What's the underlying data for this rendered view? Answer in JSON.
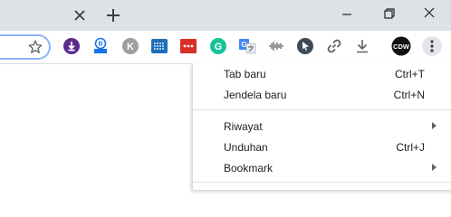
{
  "tabstrip": {
    "close_icon": "close-icon",
    "new_tab_icon": "plus-icon"
  },
  "window_controls": [
    "minimize-icon",
    "restore-icon",
    "close-icon"
  ],
  "toolbar": {
    "bookmark_icon": "star-icon",
    "extensions": [
      {
        "icon": "download-manager-icon",
        "color": "#5b2c8f"
      },
      {
        "icon": "extension-b-icon",
        "color": "#1a73e8"
      },
      {
        "icon": "k-icon",
        "color": "#9e9e9e",
        "text": "K"
      },
      {
        "icon": "grid-extension-icon",
        "color": "#1e6fb9"
      },
      {
        "icon": "red-extension-icon",
        "color": "#d93025"
      },
      {
        "icon": "grammarly-icon",
        "color": "#15c39a",
        "text": "G"
      },
      {
        "icon": "translate-icon",
        "color": "#4285f4"
      },
      {
        "icon": "audio-extension-icon",
        "color": "#5f6368"
      },
      {
        "icon": "cursor-extension-icon",
        "color": "#3c4a5c"
      },
      {
        "icon": "link-icon",
        "color": "#5f6368"
      },
      {
        "icon": "download-icon",
        "color": "#5f6368"
      }
    ],
    "profile_text": "CDW",
    "menu_icon": "more-vert-icon"
  },
  "menu": {
    "items": [
      {
        "label": "Tab baru",
        "shortcut": "Ctrl+T"
      },
      {
        "label": "Jendela baru",
        "shortcut": "Ctrl+N"
      },
      {
        "label": "Riwayat",
        "submenu": true
      },
      {
        "label": "Unduhan",
        "shortcut": "Ctrl+J"
      },
      {
        "label": "Bookmark",
        "submenu": true
      }
    ]
  }
}
